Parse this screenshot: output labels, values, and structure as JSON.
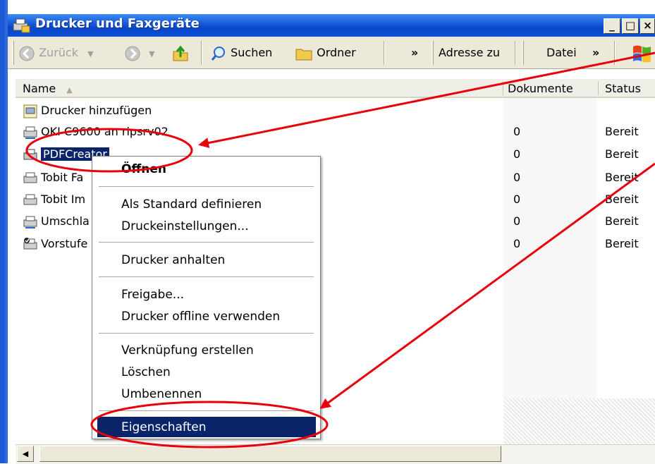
{
  "window": {
    "title": "Drucker und Faxgeräte"
  },
  "caption_buttons": {
    "minimize": "_",
    "maximize": "□",
    "close": "×"
  },
  "toolbar": {
    "back": "Zurück",
    "search": "Suchen",
    "folders": "Ordner",
    "chevron1": "»",
    "address": "Adresse",
    "go": "zu",
    "file": "Datei",
    "chevron2": "»"
  },
  "columns": {
    "name": "Name",
    "documents": "Dokumente",
    "status": "Status"
  },
  "printers": [
    {
      "name": "Drucker hinzufügen",
      "documents": "",
      "status": ""
    },
    {
      "name": "OKI C9600 an ripsrv02",
      "documents": "0",
      "status": "Bereit"
    },
    {
      "name": "PDFCreator",
      "documents": "0",
      "status": "Bereit"
    },
    {
      "name": "Tobit Fa",
      "documents": "0",
      "status": "Bereit"
    },
    {
      "name": "Tobit Im",
      "documents": "0",
      "status": "Bereit"
    },
    {
      "name": "Umschla",
      "documents": "0",
      "status": "Bereit"
    },
    {
      "name": "Vorstufe",
      "documents": "0",
      "status": "Bereit"
    }
  ],
  "context_menu": {
    "open": "Öffnen",
    "set_default": "Als Standard definieren",
    "print_prefs": "Druckeinstellungen...",
    "pause": "Drucker anhalten",
    "share": "Freigabe...",
    "offline": "Drucker offline verwenden",
    "shortcut": "Verknüpfung erstellen",
    "delete": "Löschen",
    "rename": "Umbenennen",
    "properties": "Eigenschaften"
  },
  "colors": {
    "titlebar": "#0a46c8",
    "selection": "#0a246a",
    "annotation": "#e8000b"
  }
}
